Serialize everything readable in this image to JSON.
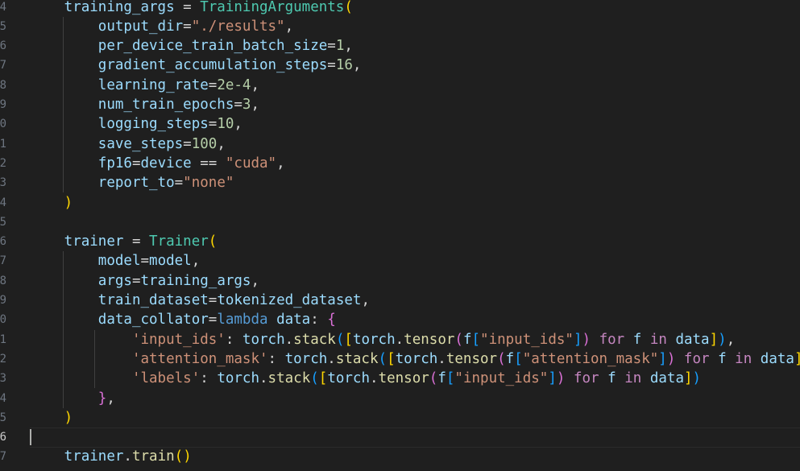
{
  "editor": {
    "language": "python",
    "active_line": 36,
    "colors": {
      "background": "#1f1f1f",
      "variable": "#9cdcfe",
      "function": "#dcdcaa",
      "class": "#4ec9b0",
      "string": "#ce9178",
      "number": "#b5cea8",
      "keyword_control": "#c586c0",
      "keyword": "#569cd6",
      "bracket_1": "#ffd700",
      "bracket_2": "#da70d6",
      "bracket_3": "#179fff",
      "plain": "#d4d4d4"
    },
    "lines": [
      {
        "n": "4",
        "tokens": [
          [
            "    ",
            "p"
          ],
          [
            "training_args",
            "v"
          ],
          [
            " = ",
            "p"
          ],
          [
            "TrainingArguments",
            "c"
          ],
          [
            "(",
            "b1"
          ]
        ]
      },
      {
        "n": "5",
        "tokens": [
          [
            "        ",
            "p"
          ],
          [
            "output_dir",
            "v"
          ],
          [
            "=",
            "p"
          ],
          [
            "\"./results\"",
            "s"
          ],
          [
            ",",
            "p"
          ]
        ]
      },
      {
        "n": "6",
        "tokens": [
          [
            "        ",
            "p"
          ],
          [
            "per_device_train_batch_size",
            "v"
          ],
          [
            "=",
            "p"
          ],
          [
            "1",
            "n"
          ],
          [
            ",",
            "p"
          ]
        ]
      },
      {
        "n": "7",
        "tokens": [
          [
            "        ",
            "p"
          ],
          [
            "gradient_accumulation_steps",
            "v"
          ],
          [
            "=",
            "p"
          ],
          [
            "16",
            "n"
          ],
          [
            ",",
            "p"
          ]
        ]
      },
      {
        "n": "8",
        "tokens": [
          [
            "        ",
            "p"
          ],
          [
            "learning_rate",
            "v"
          ],
          [
            "=",
            "p"
          ],
          [
            "2e-4",
            "n"
          ],
          [
            ",",
            "p"
          ]
        ]
      },
      {
        "n": "9",
        "tokens": [
          [
            "        ",
            "p"
          ],
          [
            "num_train_epochs",
            "v"
          ],
          [
            "=",
            "p"
          ],
          [
            "3",
            "n"
          ],
          [
            ",",
            "p"
          ]
        ]
      },
      {
        "n": "0",
        "tokens": [
          [
            "        ",
            "p"
          ],
          [
            "logging_steps",
            "v"
          ],
          [
            "=",
            "p"
          ],
          [
            "10",
            "n"
          ],
          [
            ",",
            "p"
          ]
        ]
      },
      {
        "n": "1",
        "tokens": [
          [
            "        ",
            "p"
          ],
          [
            "save_steps",
            "v"
          ],
          [
            "=",
            "p"
          ],
          [
            "100",
            "n"
          ],
          [
            ",",
            "p"
          ]
        ]
      },
      {
        "n": "2",
        "tokens": [
          [
            "        ",
            "p"
          ],
          [
            "fp16",
            "v"
          ],
          [
            "=",
            "p"
          ],
          [
            "device",
            "v"
          ],
          [
            " == ",
            "p"
          ],
          [
            "\"cuda\"",
            "s"
          ],
          [
            ",",
            "p"
          ]
        ]
      },
      {
        "n": "3",
        "tokens": [
          [
            "        ",
            "p"
          ],
          [
            "report_to",
            "v"
          ],
          [
            "=",
            "p"
          ],
          [
            "\"none\"",
            "s"
          ]
        ]
      },
      {
        "n": "4",
        "tokens": [
          [
            "    ",
            "p"
          ],
          [
            ")",
            "b1"
          ]
        ]
      },
      {
        "n": "5",
        "tokens": []
      },
      {
        "n": "6",
        "tokens": [
          [
            "    ",
            "p"
          ],
          [
            "trainer",
            "v"
          ],
          [
            " = ",
            "p"
          ],
          [
            "Trainer",
            "c"
          ],
          [
            "(",
            "b1"
          ]
        ]
      },
      {
        "n": "7",
        "tokens": [
          [
            "        ",
            "p"
          ],
          [
            "model",
            "v"
          ],
          [
            "=",
            "p"
          ],
          [
            "model",
            "v"
          ],
          [
            ",",
            "p"
          ]
        ]
      },
      {
        "n": "8",
        "tokens": [
          [
            "        ",
            "p"
          ],
          [
            "args",
            "v"
          ],
          [
            "=",
            "p"
          ],
          [
            "training_args",
            "v"
          ],
          [
            ",",
            "p"
          ]
        ]
      },
      {
        "n": "9",
        "tokens": [
          [
            "        ",
            "p"
          ],
          [
            "train_dataset",
            "v"
          ],
          [
            "=",
            "p"
          ],
          [
            "tokenized_dataset",
            "v"
          ],
          [
            ",",
            "p"
          ]
        ]
      },
      {
        "n": "0",
        "tokens": [
          [
            "        ",
            "p"
          ],
          [
            "data_collator",
            "v"
          ],
          [
            "=",
            "p"
          ],
          [
            "lambda",
            "k"
          ],
          [
            " ",
            "p"
          ],
          [
            "data",
            "v"
          ],
          [
            ": ",
            "p"
          ],
          [
            "{",
            "b2"
          ]
        ]
      },
      {
        "n": "1",
        "tokens": [
          [
            "            ",
            "p"
          ],
          [
            "'input_ids'",
            "s"
          ],
          [
            ": ",
            "p"
          ],
          [
            "torch",
            "v"
          ],
          [
            ".",
            "p"
          ],
          [
            "stack",
            "f"
          ],
          [
            "(",
            "b3"
          ],
          [
            "[",
            "b1"
          ],
          [
            "torch",
            "v"
          ],
          [
            ".",
            "p"
          ],
          [
            "tensor",
            "f"
          ],
          [
            "(",
            "b2"
          ],
          [
            "f",
            "v"
          ],
          [
            "[",
            "b3"
          ],
          [
            "\"input_ids\"",
            "s"
          ],
          [
            "]",
            "b3"
          ],
          [
            ")",
            "b2"
          ],
          [
            " ",
            "p"
          ],
          [
            "for",
            "kc"
          ],
          [
            " ",
            "p"
          ],
          [
            "f",
            "v"
          ],
          [
            " ",
            "p"
          ],
          [
            "in",
            "kc"
          ],
          [
            " ",
            "p"
          ],
          [
            "data",
            "v"
          ],
          [
            "]",
            "b1"
          ],
          [
            ")",
            "b3"
          ],
          [
            ",",
            "p"
          ]
        ]
      },
      {
        "n": "2",
        "tokens": [
          [
            "            ",
            "p"
          ],
          [
            "'attention_mask'",
            "s"
          ],
          [
            ": ",
            "p"
          ],
          [
            "torch",
            "v"
          ],
          [
            ".",
            "p"
          ],
          [
            "stack",
            "f"
          ],
          [
            "(",
            "b3"
          ],
          [
            "[",
            "b1"
          ],
          [
            "torch",
            "v"
          ],
          [
            ".",
            "p"
          ],
          [
            "tensor",
            "f"
          ],
          [
            "(",
            "b2"
          ],
          [
            "f",
            "v"
          ],
          [
            "[",
            "b3"
          ],
          [
            "\"attention_mask\"",
            "s"
          ],
          [
            "]",
            "b3"
          ],
          [
            ")",
            "b2"
          ],
          [
            " ",
            "p"
          ],
          [
            "for",
            "kc"
          ],
          [
            " ",
            "p"
          ],
          [
            "f",
            "v"
          ],
          [
            " ",
            "p"
          ],
          [
            "in",
            "kc"
          ],
          [
            " ",
            "p"
          ],
          [
            "data",
            "v"
          ],
          [
            "]",
            "b1"
          ],
          [
            ")",
            "b3"
          ],
          [
            ",",
            "p"
          ]
        ]
      },
      {
        "n": "3",
        "tokens": [
          [
            "            ",
            "p"
          ],
          [
            "'labels'",
            "s"
          ],
          [
            ": ",
            "p"
          ],
          [
            "torch",
            "v"
          ],
          [
            ".",
            "p"
          ],
          [
            "stack",
            "f"
          ],
          [
            "(",
            "b3"
          ],
          [
            "[",
            "b1"
          ],
          [
            "torch",
            "v"
          ],
          [
            ".",
            "p"
          ],
          [
            "tensor",
            "f"
          ],
          [
            "(",
            "b2"
          ],
          [
            "f",
            "v"
          ],
          [
            "[",
            "b3"
          ],
          [
            "\"input_ids\"",
            "s"
          ],
          [
            "]",
            "b3"
          ],
          [
            ")",
            "b2"
          ],
          [
            " ",
            "p"
          ],
          [
            "for",
            "kc"
          ],
          [
            " ",
            "p"
          ],
          [
            "f",
            "v"
          ],
          [
            " ",
            "p"
          ],
          [
            "in",
            "kc"
          ],
          [
            " ",
            "p"
          ],
          [
            "data",
            "v"
          ],
          [
            "]",
            "b1"
          ],
          [
            ")",
            "b3"
          ]
        ]
      },
      {
        "n": "4",
        "tokens": [
          [
            "        ",
            "p"
          ],
          [
            "}",
            "b2"
          ],
          [
            ",",
            "p"
          ]
        ]
      },
      {
        "n": "5",
        "tokens": [
          [
            "    ",
            "p"
          ],
          [
            ")",
            "b1"
          ]
        ]
      },
      {
        "n": "6",
        "tokens": []
      },
      {
        "n": "7",
        "tokens": [
          [
            "    ",
            "p"
          ],
          [
            "trainer",
            "v"
          ],
          [
            ".",
            "p"
          ],
          [
            "train",
            "f"
          ],
          [
            "()",
            "b1"
          ]
        ]
      }
    ]
  }
}
